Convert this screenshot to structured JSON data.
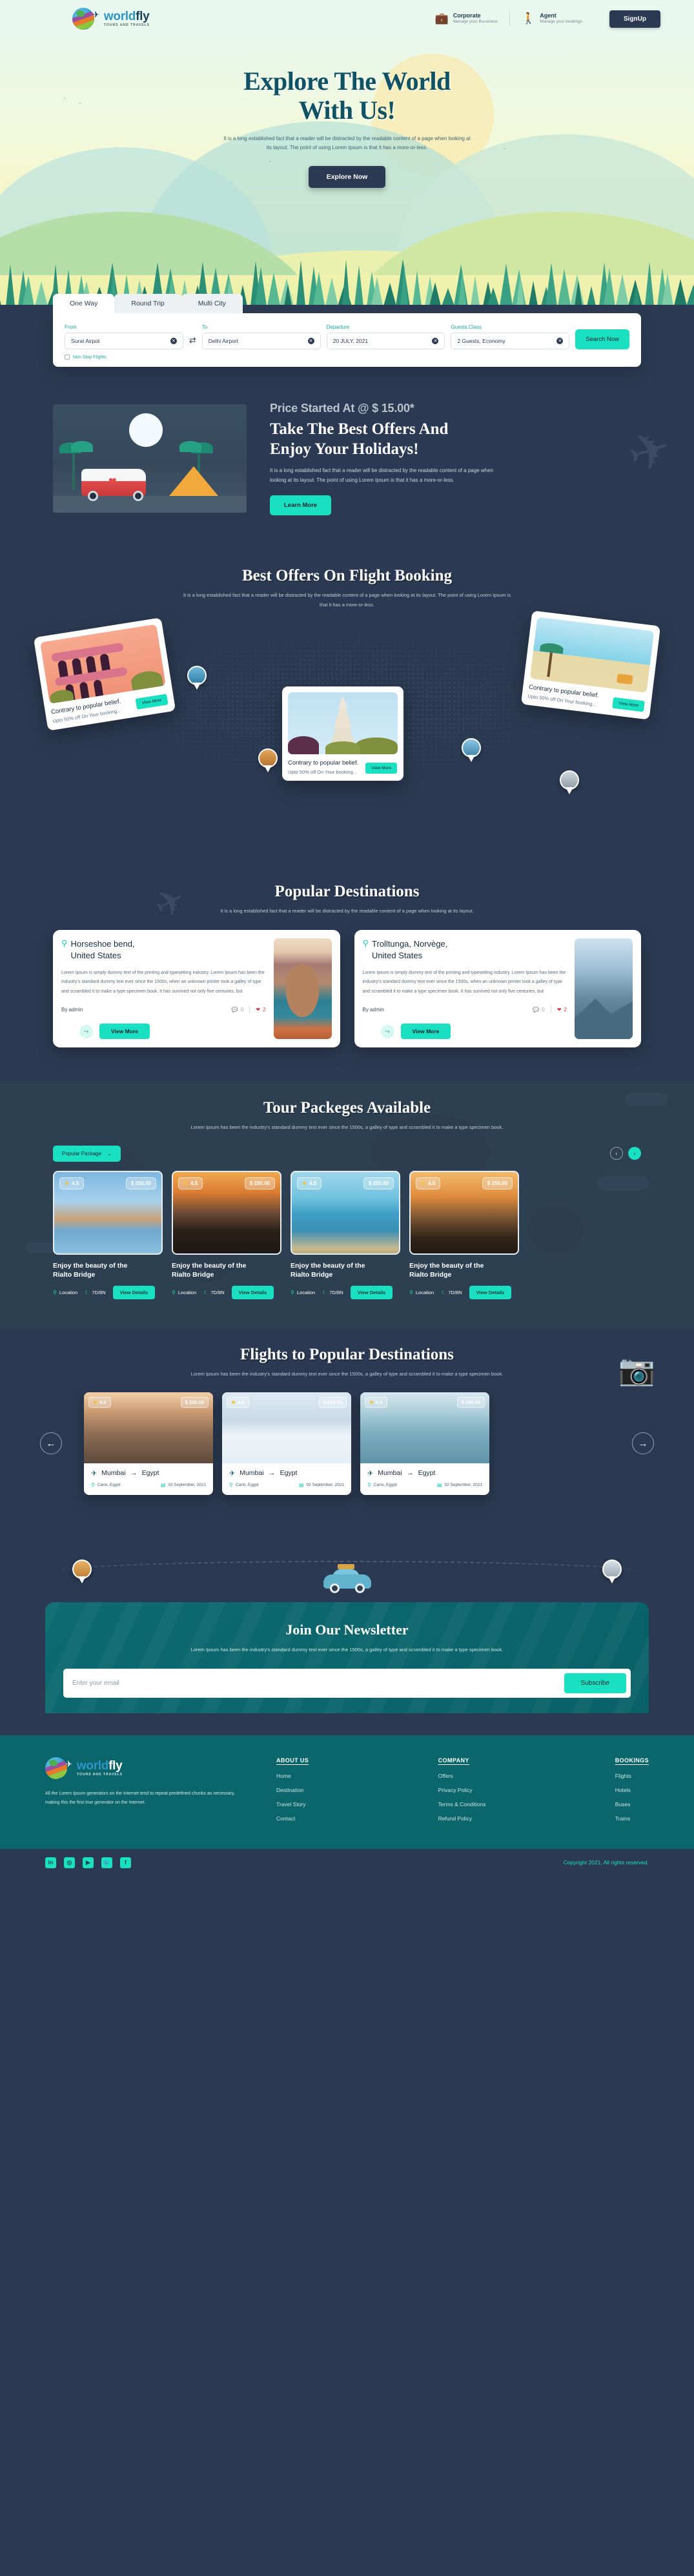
{
  "brand": {
    "word1": "world",
    "word2": "fly",
    "tagline": "TOURS AND TRAVELS"
  },
  "header": {
    "corporate": {
      "title": "Corporate",
      "sub": "Manage your Bussiness",
      "icon": "briefcase-icon"
    },
    "agent": {
      "title": "Agent",
      "sub": "Manage your bookings",
      "icon": "hiker-icon"
    },
    "signup": "SignUp"
  },
  "hero": {
    "title_line1": "Explore The World",
    "title_line2": "With Us!",
    "paragraph": "It is a long established fact that a reader will be distracted by the readable content of a page when looking at its layout. The point of using Lorem Ipsum is that it has a more-or-less.",
    "cta": "Explore Now"
  },
  "search": {
    "tabs": [
      {
        "label": "One Way",
        "active": true
      },
      {
        "label": "Round Trip",
        "active": false
      },
      {
        "label": "Multi City",
        "active": false
      }
    ],
    "from": {
      "label": "From",
      "value": "Surat Airpot"
    },
    "to": {
      "label": "To",
      "value": "Delhi Airport"
    },
    "departure": {
      "label": "Departure",
      "value": "20 JULY, 2021"
    },
    "guests": {
      "label": "Guests,Class",
      "value": "2 Guests, Economy"
    },
    "search_button": "Search Now",
    "nonstop": "Non Stop Flights"
  },
  "promo": {
    "kicker": "Price Started At @ $ 15.00*",
    "title_l1": "Take The Best Offers And",
    "title_l2": "Enjoy Your Holidays!",
    "paragraph": "It is a long established fact that a reader will be distracted by the readable content of a page when looking at its layout. The point of using Lorem Ipsum is that it has a more-or-less.",
    "cta": "Learn More"
  },
  "offers": {
    "title": "Best Offers On Flight Booking",
    "subtitle": "It is a long established fact that a reader will be distracted by the readable content of a page when looking at its layout. The point of using Lorem Ipsum is that it has a more-or-less.",
    "cards": [
      {
        "title": "Contrary to popular belief.",
        "sub": "Upto 50% off On Your booking...",
        "cta": "View More"
      },
      {
        "title": "Contrary to popular belief.",
        "sub": "Upto 50% off On Your booking...",
        "cta": "View More"
      },
      {
        "title": "Contrary to popular belief.",
        "sub": "Upto 50% off On Your booking...",
        "cta": "View More"
      }
    ]
  },
  "popular": {
    "title": "Popular Destinations",
    "subtitle": "It is a long established fact that a reader will be distracted by the readable content of a page when looking at its layout.",
    "cards": [
      {
        "name_l1": "Horseshoe bend,",
        "name_l2": "United States",
        "desc": "Lorem Ipsum is simply dummy text of the printing and typesetting industry. Lorem Ipsum has been the industry's standard dummy text ever since the 1500s, when an unknown printer took a galley of type and scrambled it to make a type specimen book. It has survived not only five centuries, but",
        "by": "By admin",
        "comments": "0",
        "likes": "2",
        "cta": "View More"
      },
      {
        "name_l1": "Trolltunga, Norvège,",
        "name_l2": "United States",
        "desc": "Lorem Ipsum is simply dummy text of the printing and typesetting industry. Lorem Ipsum has been the industry's standard dummy text ever since the 1500s, when an unknown printer took a galley of type and scrambled it to make a type specimen book. It has survived not only five centuries, but",
        "by": "By admin",
        "comments": "0",
        "likes": "2",
        "cta": "View More"
      }
    ]
  },
  "tours": {
    "title": "Tour Packeges Available",
    "subtitle": "Lorem Ipsum has been the industry's standard dummy text ever since the 1500s, a galley of type and scrambled it to make a type specimen book.",
    "filter": "Popular Package",
    "cards": [
      {
        "rating": "4.5",
        "price": "$ 250.00",
        "title_l1": "Enjoy the beauty of the",
        "title_l2": "Rialto Bridge",
        "location": "Location",
        "duration": "7D/8N",
        "cta": "View Details"
      },
      {
        "rating": "4.5",
        "price": "$ 250.00",
        "title_l1": "Enjoy the beauty of the",
        "title_l2": "Rialto Bridge",
        "location": "Location",
        "duration": "7D/8N",
        "cta": "View Details"
      },
      {
        "rating": "4.5",
        "price": "$ 250.00",
        "title_l1": "Enjoy the beauty of the",
        "title_l2": "Rialto Bridge",
        "location": "Location",
        "duration": "7D/8N",
        "cta": "View Details"
      },
      {
        "rating": "4.5",
        "price": "$ 250.00",
        "title_l1": "Enjoy the beauty of the",
        "title_l2": "Rialto Bridge",
        "location": "Location",
        "duration": "7D/8N",
        "cta": "View Details"
      }
    ]
  },
  "flights": {
    "title": "Flights to Popular Destinations",
    "subtitle": "Lorem Ipsum has been the industry's standard dummy text ever since the 1500s, a galley of type and scrambled it to make a type specimen book.",
    "cards": [
      {
        "rating": "4.5",
        "price": "$ 250.00",
        "origin": "Mumbai",
        "destination": "Egypt",
        "place": "Cario, Egypt",
        "date": "02 September, 2021"
      },
      {
        "rating": "4.5",
        "price": "$ 250.00",
        "origin": "Mumbai",
        "destination": "Egypt",
        "place": "Cario, Egypt",
        "date": "02 September, 2021"
      },
      {
        "rating": "4.5",
        "price": "$ 250.00",
        "origin": "Mumbai",
        "destination": "Egypt",
        "place": "Cario, Egypt",
        "date": "02 September, 2021"
      }
    ]
  },
  "newsletter": {
    "title": "Join Our Newsletter",
    "subtitle": "Lorem Ipsum has been the industry's standard dummy text ever since the 1500s, a galley of type and scrambled it to make a type specimen book.",
    "placeholder": "Enter your email",
    "button": "Subscribe"
  },
  "footer": {
    "desc": "All the Lorem Ipsum generators on the Internet tend to repeat predefined chunks as necessary, making this the first true generator on the Internet.",
    "columns": [
      {
        "heading": "ABOUT US",
        "links": [
          "Home",
          "Destination",
          "Travel Story",
          "Contact"
        ]
      },
      {
        "heading": "COMPANY",
        "links": [
          "Offers",
          "Privacy Policy",
          "Terms & Conditions",
          "Refund Policy"
        ]
      },
      {
        "heading": "BOOKINGS",
        "links": [
          "Flights",
          "Hotels",
          "Buses",
          "Trains"
        ]
      }
    ],
    "social": [
      "in",
      "◎",
      "▶",
      "🐦",
      "f"
    ],
    "copyright": "Copyright  2021, All rights reserved."
  },
  "colors": {
    "accent": "#19e0c0",
    "dark": "#2b3a52",
    "teal": "#0b666c"
  }
}
